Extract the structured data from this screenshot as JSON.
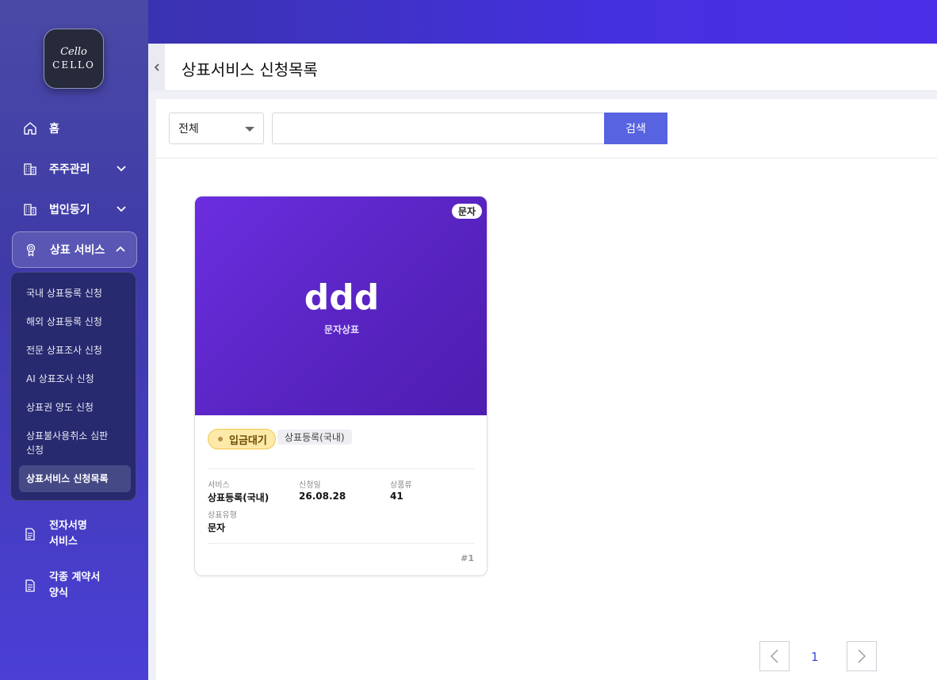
{
  "logo": {
    "script": "Cello",
    "word": "CELLO"
  },
  "sidebar": {
    "items": [
      {
        "label": "홈",
        "icon": "home-icon"
      },
      {
        "label": "주주관리",
        "icon": "building-icon"
      },
      {
        "label": "법인등기",
        "icon": "building-icon"
      },
      {
        "label": "상표 서비스",
        "icon": "award-icon"
      },
      {
        "label": "전자서명\n서비스",
        "icon": "document-icon"
      },
      {
        "label": "각종 계약서\n양식",
        "icon": "document-icon"
      }
    ],
    "submenu": [
      "국내 상표등록 신청",
      "해외 상표등록 신청",
      "전문 상표조사 신청",
      "AI 상표조사 신청",
      "상표권 양도 신청",
      "상표불사용취소 심판 신청",
      "상표서비스 신청목록"
    ]
  },
  "header": {
    "title": "상표서비스 신청목록"
  },
  "search": {
    "select_value": "전체",
    "input_value": "",
    "button_label": "검색"
  },
  "card": {
    "type_badge": "문자",
    "mark_name": "ddd",
    "mark_sub": "문자상표",
    "status": "입금대기",
    "service_chip": "상표등록(국내)",
    "meta": {
      "service_label": "서비스",
      "service_value": "상표등록(국내)",
      "date_label": "신청일",
      "date_value": "26.08.28",
      "class_label": "상품류",
      "class_value": "41",
      "type_label": "상표유형",
      "type_value": "문자"
    },
    "number": "#1"
  },
  "pager": {
    "current": "1"
  },
  "colors": {
    "accent": "#5763e0",
    "hero": "#5a25c4",
    "status_bg": "#fde9a8"
  }
}
